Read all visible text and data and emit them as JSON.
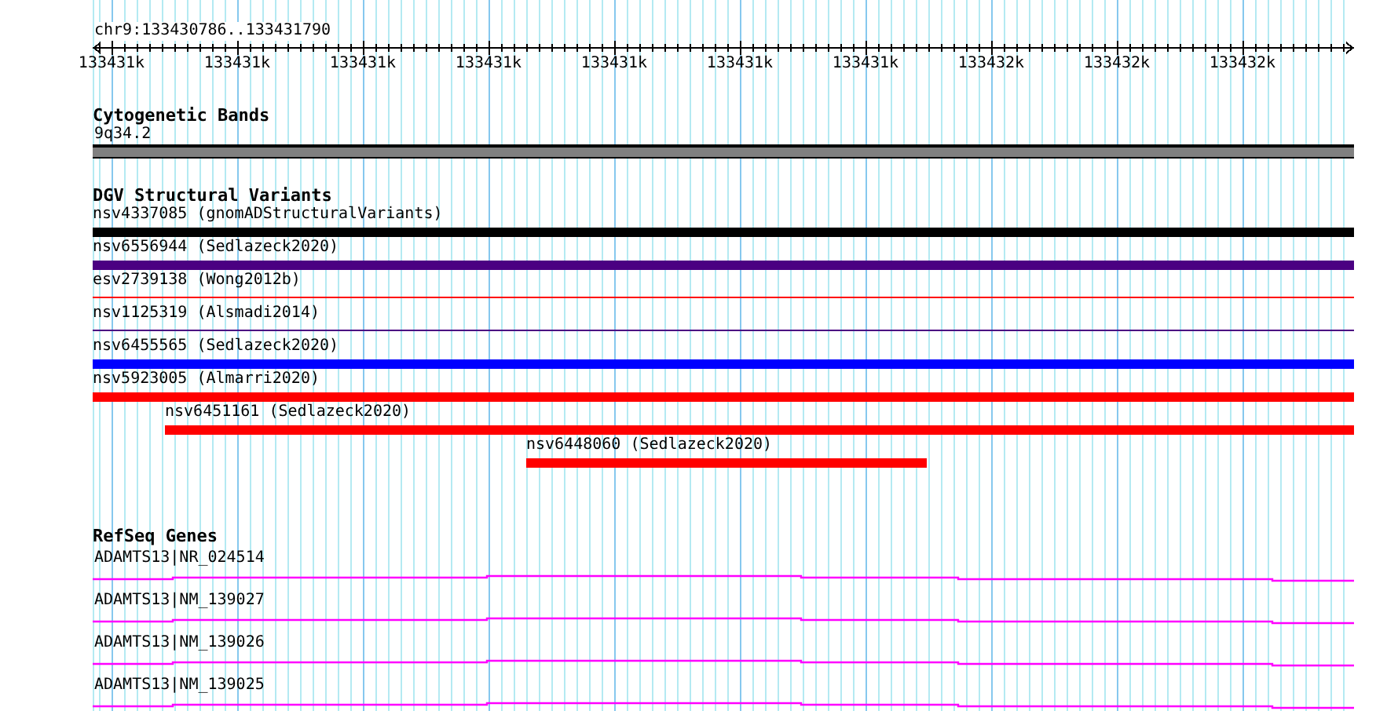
{
  "location": "chr9:133430786..133431790",
  "ruler": {
    "labels": [
      "133431k",
      "133431k",
      "133431k",
      "133431k",
      "133431k",
      "133431k",
      "133431k",
      "133432k",
      "133432k",
      "133432k"
    ]
  },
  "tracks": [
    {
      "kind": "band",
      "title": "Cytogenetic Bands",
      "features": [
        {
          "label": "9q34.2"
        }
      ]
    },
    {
      "kind": "variant",
      "title": "DGV Structural Variants",
      "features": [
        {
          "label": "nsv4337085 (gnomADStructuralVariants)",
          "color": "#000000",
          "kind": "thick"
        },
        {
          "label": "nsv6556944 (Sedlazeck2020)",
          "color": "#4b0082",
          "kind": "thick"
        },
        {
          "label": "esv2739138 (Wong2012b)",
          "color": "#ff0000",
          "kind": "thin"
        },
        {
          "label": "nsv1125319 (Alsmadi2014)",
          "color": "#4b0082",
          "kind": "thin"
        },
        {
          "label": "nsv6455565 (Sedlazeck2020)",
          "color": "#0000ff",
          "kind": "thick"
        },
        {
          "label": "nsv5923005 (Almarri2020)",
          "color": "#ff0000",
          "kind": "thick"
        },
        {
          "label": "nsv6451161 (Sedlazeck2020)",
          "color": "#ff0000",
          "kind": "thick"
        },
        {
          "label": "nsv6448060 (Sedlazeck2020)",
          "color": "#ff0000",
          "kind": "thick"
        }
      ]
    },
    {
      "kind": "gene",
      "title": "RefSeq Genes",
      "features": [
        {
          "label": "ADAMTS13|NR_024514"
        },
        {
          "label": "ADAMTS13|NM_139027"
        },
        {
          "label": "ADAMTS13|NM_139026"
        },
        {
          "label": "ADAMTS13|NM_139025"
        }
      ]
    }
  ]
}
